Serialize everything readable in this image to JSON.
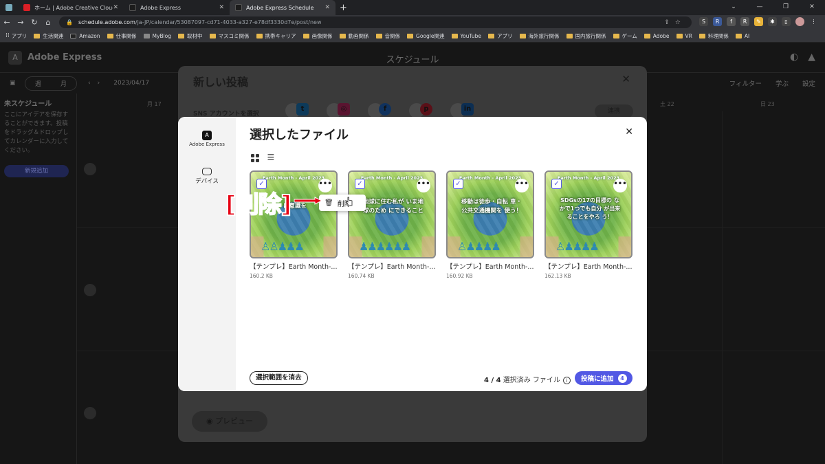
{
  "browser": {
    "tabs": [
      {
        "label": "ホーム | Adobe Creative Cloud",
        "color": "#da1f26"
      },
      {
        "label": "Adobe Express",
        "color": "#3a3a3a"
      },
      {
        "label": "Adobe Express Schedule",
        "color": "#3a3a3a"
      }
    ],
    "url_host": "schedule.adobe.com",
    "url_path": "/ja-JP/calendar/53087097-cd71-4033-a327-e78df3330d7e/post/new",
    "bookmarks": [
      "アプリ",
      "生活関連",
      "Amazon",
      "仕事関係",
      "MyBlog",
      "取材中",
      "マスコミ関係",
      "携帯キャリア",
      "画像関係",
      "動画関係",
      "音関係",
      "Google関連",
      "YouTube",
      "アプリ",
      "海外旅行関係",
      "国内旅行関係",
      "ゲーム",
      "Adobe",
      "VR",
      "料理関係",
      "AI"
    ]
  },
  "app": {
    "name": "Adobe Express",
    "page_title": "スケジュール",
    "view_week": "週",
    "view_month": "月",
    "date": "2023/04/17",
    "filter": "フィルター",
    "learn": "学ぶ",
    "settings": "設定",
    "unscheduled_title": "未スケジュール",
    "unscheduled_text": "ここにアイデアを保存することができます。投稿をドラッグ＆ドロップしてカレンダーに入力してください。",
    "new_add": "新規追加",
    "days": [
      "月 17",
      "土 22",
      "日 23"
    ]
  },
  "back_modal": {
    "title": "新しい投稿",
    "sns_label": "SNS アカウントを選択",
    "connect": "連携",
    "preview": "プレビュー",
    "accounts": [
      {
        "icon": "twitter",
        "color": "#1d9bf0"
      },
      {
        "icon": "instagram",
        "color": "#e1306c"
      },
      {
        "icon": "facebook",
        "color": "#1877f2"
      },
      {
        "icon": "pinterest",
        "color": "#e60023"
      },
      {
        "icon": "linkedin",
        "color": "#0a66c2"
      }
    ]
  },
  "modal": {
    "title": "選択したファイル",
    "side_express": "Adobe Express",
    "side_device": "デバイス",
    "files": [
      {
        "name": "【テンプレ】Earth Month-...",
        "size": "160.2 KB",
        "banner": "Earth Month - April 2023",
        "msg": "に意識を"
      },
      {
        "name": "【テンプレ】Earth Month-...",
        "size": "160.74 KB",
        "banner": "Earth Month - April 2023",
        "msg": "地球に住む私が いま地球のため にできること"
      },
      {
        "name": "【テンプレ】Earth Month-...",
        "size": "160.92 KB",
        "banner": "Earth Month - April 2023",
        "msg": "移動は徒歩・自転 車・公共交通機関を 使う！"
      },
      {
        "name": "【テンプレ】Earth Month-...",
        "size": "162.13 KB",
        "banner": "Earth Month - April 2023",
        "msg": "SDGsの17の目標の なかで1つでも自分 が出来ることをやろ う！"
      }
    ],
    "context_delete": "削除",
    "clear_selection": "選択範囲を消去",
    "count_bold": "4 / 4",
    "count_text": "選択済み ファイル",
    "add_to_post": "投稿に追加",
    "add_badge": "4"
  },
  "annotation": {
    "text": "[削除]",
    "color": "#e60012"
  }
}
